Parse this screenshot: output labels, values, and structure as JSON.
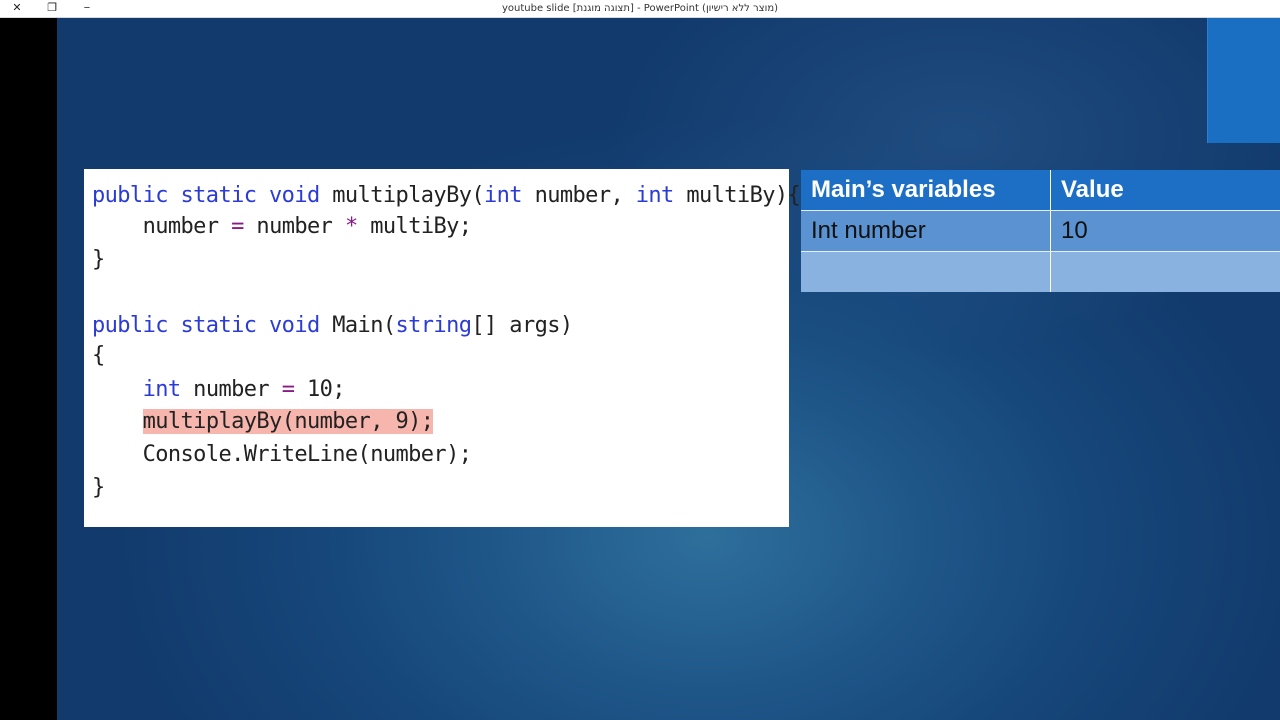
{
  "window": {
    "title": "youtube slide [תצוגה מוגנת] - PowerPoint (מוצר ללא רישיון)",
    "close_glyph": "✕",
    "restore_glyph": "❐",
    "minimize_glyph": "−"
  },
  "code": {
    "lines": [
      {
        "indent": "",
        "parts": [
          [
            "kw",
            "public static void"
          ],
          [
            "",
            " multiplayBy("
          ],
          [
            "kw",
            "int"
          ],
          [
            "",
            " number, "
          ],
          [
            "kw",
            "int"
          ],
          [
            "",
            " multiBy){"
          ]
        ]
      },
      {
        "indent": "    ",
        "parts": [
          [
            "",
            "number "
          ],
          [
            "op",
            "="
          ],
          [
            "",
            " number "
          ],
          [
            "op",
            "*"
          ],
          [
            "",
            " multiBy;"
          ]
        ]
      },
      {
        "indent": "",
        "parts": [
          [
            "",
            "}"
          ]
        ]
      },
      {
        "indent": "",
        "parts": [
          [
            "kw",
            "public static void"
          ],
          [
            "",
            " Main("
          ],
          [
            "kw",
            "string"
          ],
          [
            "",
            "[] args)"
          ]
        ]
      },
      {
        "indent": "",
        "parts": [
          [
            "",
            "{"
          ]
        ]
      },
      {
        "indent": "    ",
        "parts": [
          [
            "kw",
            "int"
          ],
          [
            "",
            " number "
          ],
          [
            "op",
            "="
          ],
          [
            "",
            " 10;"
          ]
        ]
      },
      {
        "indent": "    ",
        "parts": [
          [
            "hl",
            "multiplayBy(number, 9);"
          ]
        ]
      },
      {
        "indent": "    ",
        "parts": [
          [
            "",
            "Console.WriteLine(number);"
          ]
        ]
      },
      {
        "indent": "",
        "parts": [
          [
            "",
            "}"
          ]
        ]
      }
    ]
  },
  "variables_table": {
    "headers": [
      "Main’s variables",
      "Value"
    ],
    "rows": [
      [
        "Int number",
        "10"
      ],
      [
        "",
        ""
      ]
    ]
  },
  "colors": {
    "keyword": "#2b3bd6",
    "operator": "#8a1a8a",
    "highlight": "#f7b6ad",
    "table_header": "#1d6fc6"
  }
}
